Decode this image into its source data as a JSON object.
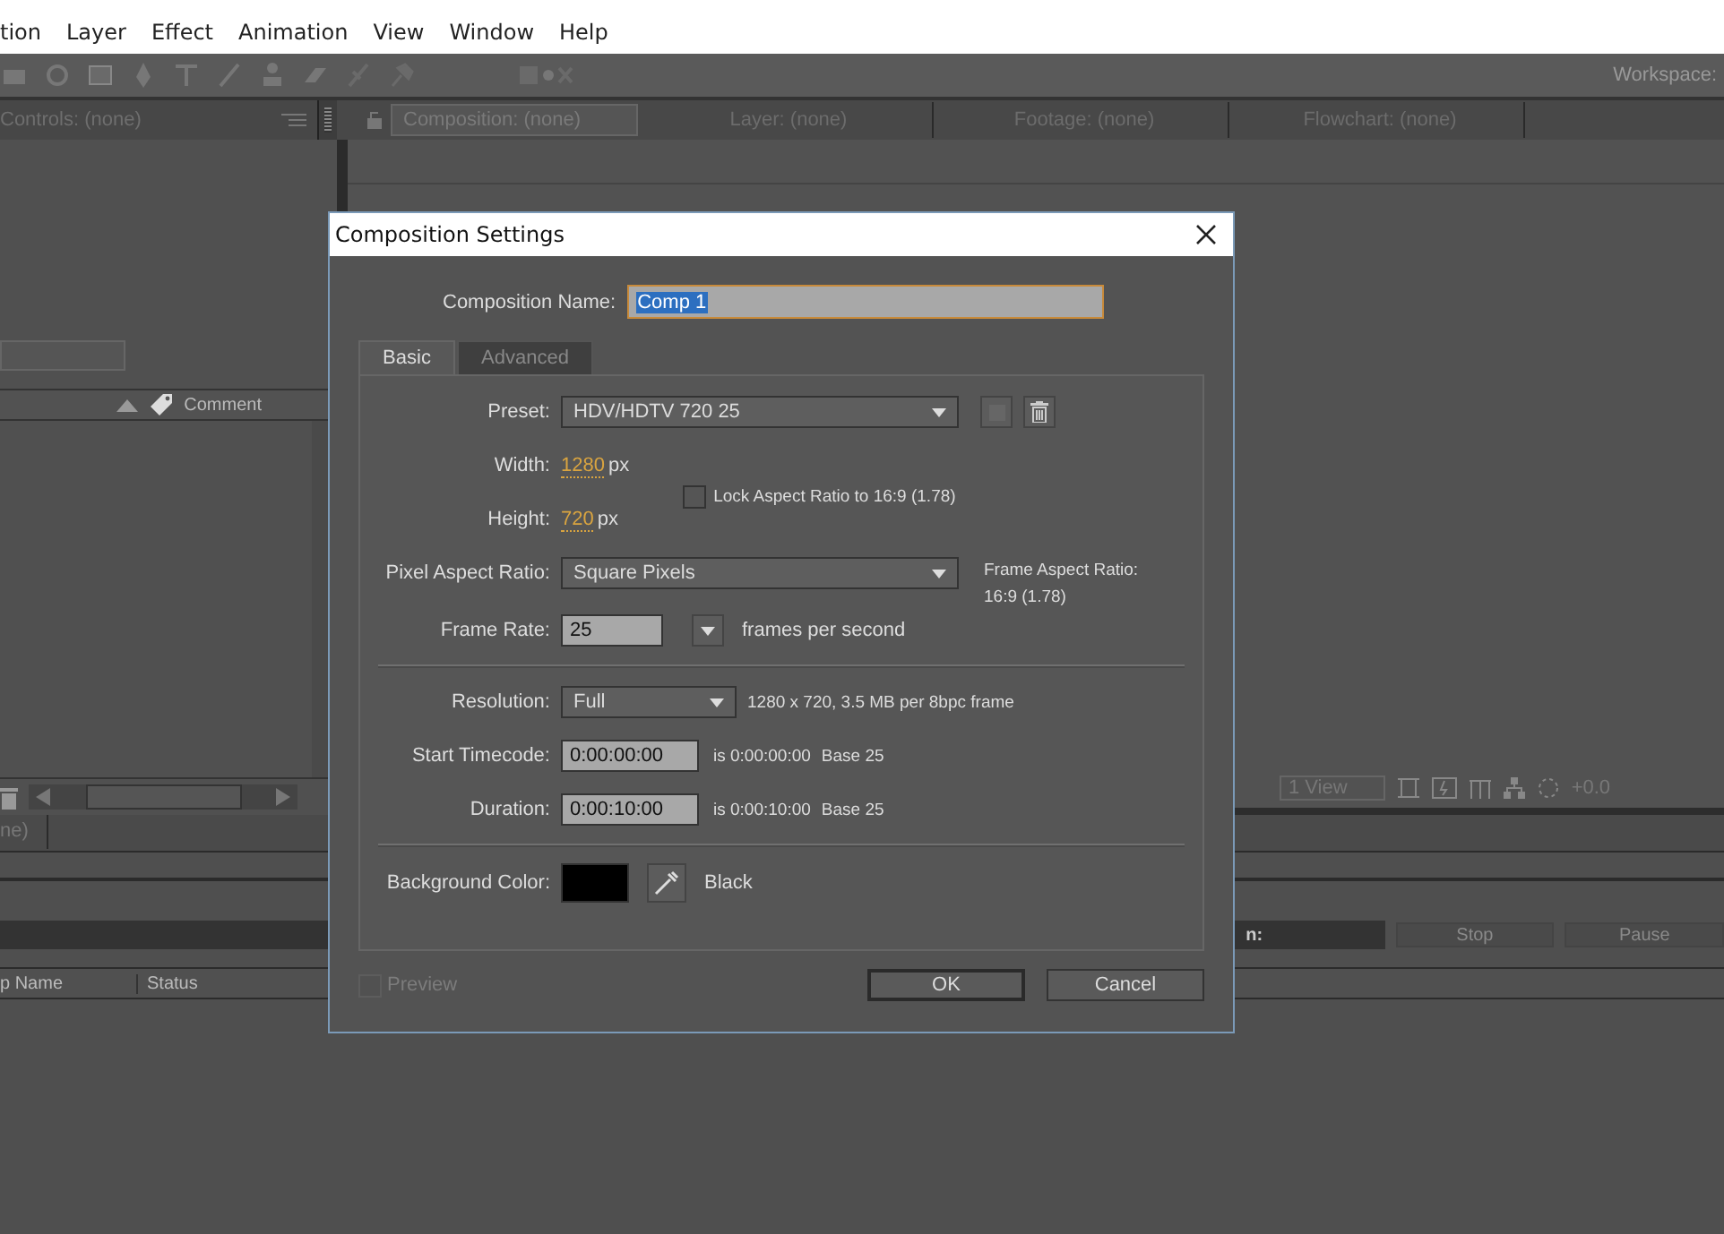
{
  "menu": [
    {
      "label": "tion"
    },
    {
      "label": "Layer"
    },
    {
      "label": "Effect"
    },
    {
      "label": "Animation"
    },
    {
      "label": "View"
    },
    {
      "label": "Window"
    },
    {
      "label": "Help"
    }
  ],
  "toolbar": {
    "workspace_label": "Workspace:"
  },
  "left_panel": {
    "tab": "Controls: (none)",
    "column": "Comment"
  },
  "viewer_tabs": [
    {
      "label": "Composition: (none)",
      "selected": true
    },
    {
      "label": "Layer: (none)",
      "selected": false
    },
    {
      "label": "Footage: (none)",
      "selected": false
    },
    {
      "label": "Flowchart: (none)",
      "selected": false
    }
  ],
  "viewer_toolbar": {
    "view": "1 View",
    "exposure": "+0.0"
  },
  "lower_panel": {
    "tab": "ne)",
    "render_label": "n:",
    "buttons": [
      "Stop",
      "Pause"
    ],
    "columns": [
      "p Name",
      "Status"
    ]
  },
  "dialog": {
    "title": "Composition Settings",
    "name_label": "Composition Name:",
    "name_value": "Comp 1",
    "tabs": [
      {
        "label": "Basic",
        "selected": true
      },
      {
        "label": "Advanced",
        "selected": false
      }
    ],
    "preset_label": "Preset:",
    "preset_value": "HDV/HDTV 720 25",
    "width_label": "Width:",
    "width_value": "1280",
    "width_unit": "px",
    "height_label": "Height:",
    "height_value": "720",
    "height_unit": "px",
    "lock_label": "Lock Aspect Ratio to 16:9 (1.78)",
    "lock_checked": false,
    "par_label": "Pixel Aspect Ratio:",
    "par_value": "Square Pixels",
    "frame_aspect_label": "Frame Aspect Ratio:",
    "frame_aspect_value": "16:9 (1.78)",
    "frame_rate_label": "Frame Rate:",
    "frame_rate_value": "25",
    "frame_rate_unit": "frames per second",
    "resolution_label": "Resolution:",
    "resolution_value": "Full",
    "resolution_info": "1280 x 720, 3.5 MB per 8bpc frame",
    "start_label": "Start Timecode:",
    "start_value": "0:00:00:00",
    "start_info": "is 0:00:00:00",
    "start_base": "Base 25",
    "duration_label": "Duration:",
    "duration_value": "0:00:10:00",
    "duration_info": "is 0:00:10:00",
    "duration_base": "Base 25",
    "bg_label": "Background Color:",
    "bg_name": "Black",
    "preview_label": "Preview",
    "preview_checked": false,
    "buttons": [
      "OK",
      "Cancel"
    ]
  }
}
